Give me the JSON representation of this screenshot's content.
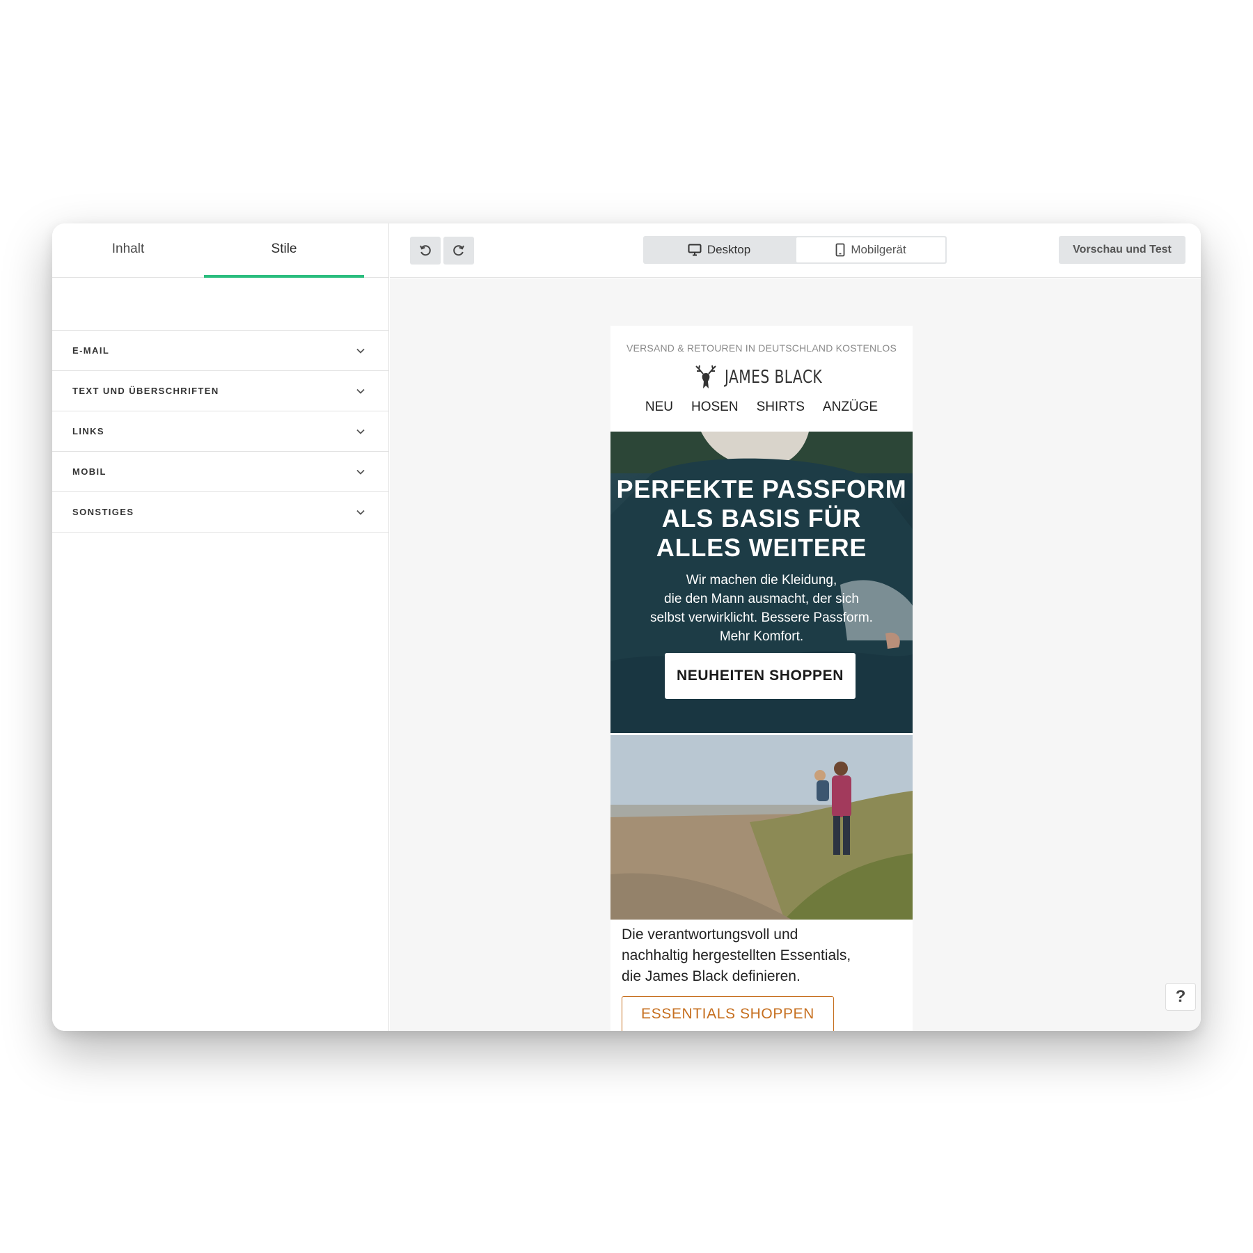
{
  "sidebar": {
    "tabs": [
      {
        "label": "Inhalt",
        "active": false
      },
      {
        "label": "Stile",
        "active": true
      }
    ],
    "sections": [
      {
        "label": "E-MAIL"
      },
      {
        "label": "TEXT UND ÜBERSCHRIFTEN"
      },
      {
        "label": "LINKS"
      },
      {
        "label": "MOBIL"
      },
      {
        "label": "SONSTIGES"
      }
    ]
  },
  "toolbar": {
    "undo_icon": "undo-icon",
    "redo_icon": "redo-icon",
    "view_options": [
      {
        "label": "Desktop",
        "icon": "monitor-icon",
        "selected": false
      },
      {
        "label": "Mobilgerät",
        "icon": "phone-icon",
        "selected": true
      }
    ],
    "preview_label": "Vorschau und Test"
  },
  "email": {
    "preheader": "VERSAND & RETOUREN IN DEUTSCHLAND KOSTENLOS",
    "logo_text": "JAMES BLACK",
    "logo_icon": "stag-icon",
    "nav": [
      "NEU",
      "HOSEN",
      "SHIRTS",
      "ANZÜGE"
    ],
    "hero": {
      "title_lines": [
        "PERFEKTE PASSFORM",
        "ALS BASIS FÜR",
        "ALLES WEITERE"
      ],
      "text_lines": [
        "Wir machen die Kleidung,",
        "die den Mann ausmacht, der sich",
        "selbst verwirklicht. Bessere Passform.",
        "Mehr Komfort."
      ],
      "button": "NEUHEITEN SHOPPEN"
    },
    "body_lines": [
      "Die verantwortungsvoll und",
      "nachhaltig hergestellten Essentials,",
      "die James Black definieren."
    ],
    "essentials_button": "ESSENTIALS SHOPPEN"
  },
  "help_label": "?",
  "colors": {
    "accent_green": "#2bbd7e",
    "cta_orange": "#c66f1f",
    "hero_teal": "#1c3a44"
  }
}
